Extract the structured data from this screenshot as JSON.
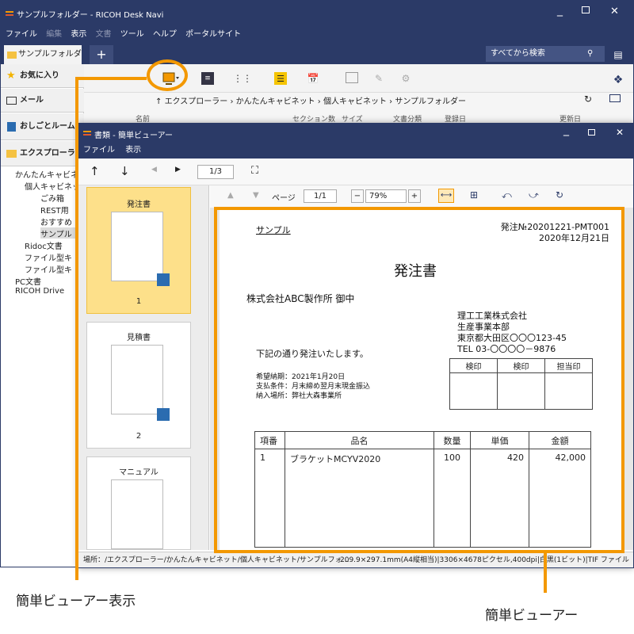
{
  "main_window": {
    "title": "サンプルフォルダー - RICOH Desk Navi",
    "menu": [
      "ファイル",
      "編集",
      "表示",
      "文書",
      "ツール",
      "ヘルプ",
      "ポータルサイト"
    ],
    "tab_label": "サンプルフォルダー",
    "search_label": "すべてから検索",
    "sidebar_buttons": [
      "お気に入り",
      "メール",
      "おしごとルーム",
      "エクスプローラー"
    ],
    "tree": [
      "かんたんキャビネット",
      "個人キャビネット",
      "ごみ箱",
      "REST用",
      "おすすめ",
      "サンプル",
      "Ridoc文書",
      "ファイル型キ",
      "ファイル型キ",
      "PC文書",
      "RICOH Drive"
    ],
    "breadcrumb": [
      "エクスプローラー",
      "かんたんキャビネット",
      "個人キャビネット",
      "サンプルフォルダー"
    ],
    "columns": [
      "名前",
      "セクション数",
      "サイズ",
      "文書分類",
      "登録日",
      "更新日"
    ]
  },
  "viewer": {
    "title": "書類 - 簡単ビューアー",
    "menu": [
      "ファイル",
      "表示"
    ],
    "page_counter": "1/3",
    "page_label": "ページ",
    "page_box": "1/1",
    "zoom": "79%",
    "thumbnails": [
      {
        "title": "発注書",
        "number": "1"
      },
      {
        "title": "見積書",
        "number": "2"
      },
      {
        "title": "マニュアル",
        "number": ""
      }
    ],
    "status_path": "場所：/エクスプローラー/かんたんキャビネット/個人キャビネット/サンプルフォ…",
    "status_info": "209.9×297.1mm(A4縦相当)|3306×4678ピクセル,400dpi|白黒(1ビット)|TIF ファイル"
  },
  "document": {
    "sample": "サンプル",
    "order_no": "発注№20201221-PMT001",
    "date": "2020年12月21日",
    "title": "発注書",
    "recipient": "株式会社ABC製作所  御中",
    "sender": [
      "理工工業株式会社",
      "生産事業本部",
      "東京都大田区〇〇〇123-45",
      "TEL  03-〇〇〇〇－9876"
    ],
    "intro": "下記の通り発注いたします。",
    "terms": [
      "希望納期：2021年1月20日",
      "支払条件：月末締め翌月末現金振込",
      "納入場所：弊社大森事業所"
    ],
    "stamps": [
      "検印",
      "検印",
      "担当印"
    ],
    "table_headers": [
      "項番",
      "品名",
      "数量",
      "単価",
      "金額"
    ],
    "rows": [
      {
        "no": "1",
        "name": "ブラケットMCYV2020",
        "qty": "100",
        "price": "420",
        "amount": "42,000"
      }
    ]
  },
  "callouts": {
    "left": "簡単ビューアー表示",
    "right": "簡単ビューアー"
  },
  "colors": {
    "accent": "#f39800",
    "titlebar": "#2b3a67",
    "thumb_selected": "#fde08a"
  }
}
